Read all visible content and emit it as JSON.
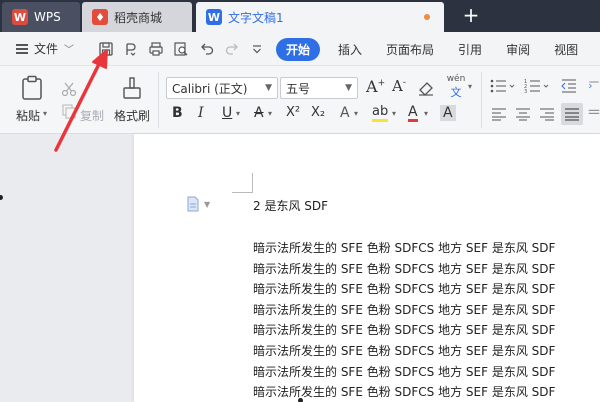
{
  "tabs": [
    {
      "label": "WPS",
      "icon": "wps-logo-icon"
    },
    {
      "label": "稻壳商城",
      "icon": "daoke-flame-icon"
    },
    {
      "label": "文字文稿1",
      "icon": "writer-doc-icon"
    }
  ],
  "menubar": {
    "file_label": "文件",
    "items": [
      "开始",
      "插入",
      "页面布局",
      "引用",
      "审阅",
      "视图"
    ],
    "active": "开始"
  },
  "ribbon": {
    "paste_label": "粘贴",
    "copy_label": "复制",
    "format_painter_label": "格式刷",
    "font_name": "Calibri (正文)",
    "font_size": "五号",
    "phonetic_label": "wén",
    "bold": "B",
    "italic": "I",
    "underline": "U",
    "strike": "A",
    "superscript": "X²",
    "subscript": "X₂",
    "font_effect": "A",
    "highlight": "ab",
    "font_color": "A",
    "char_shading": "A"
  },
  "document": {
    "heading": "2 是东风 SDF",
    "lines": [
      "暗示法所发生的 SFE 色粉 SDFCS 地方 SEF 是东风 SDF",
      "暗示法所发生的 SFE 色粉 SDFCS 地方 SEF 是东风 SDF",
      "暗示法所发生的 SFE 色粉 SDFCS 地方 SEF 是东风 SDF",
      "暗示法所发生的 SFE 色粉 SDFCS 地方 SEF 是东风 SDF",
      "暗示法所发生的 SFE 色粉 SDFCS 地方 SEF 是东风 SDF",
      "暗示法所发生的 SFE 色粉 SDFCS 地方 SEF 是东风 SDF",
      "暗示法所发生的 SFE 色粉 SDFCS 地方 SEF 是东风 SDF",
      "暗示法所发生的 SFE 色粉 SDFCS 地方 SEF 是东风 SDF"
    ]
  },
  "colors": {
    "accent": "#2f6fe6",
    "tabbar_bg": "#2d3240",
    "annotation_arrow": "#e8363a",
    "unsaved_dot": "#f08a3c"
  }
}
